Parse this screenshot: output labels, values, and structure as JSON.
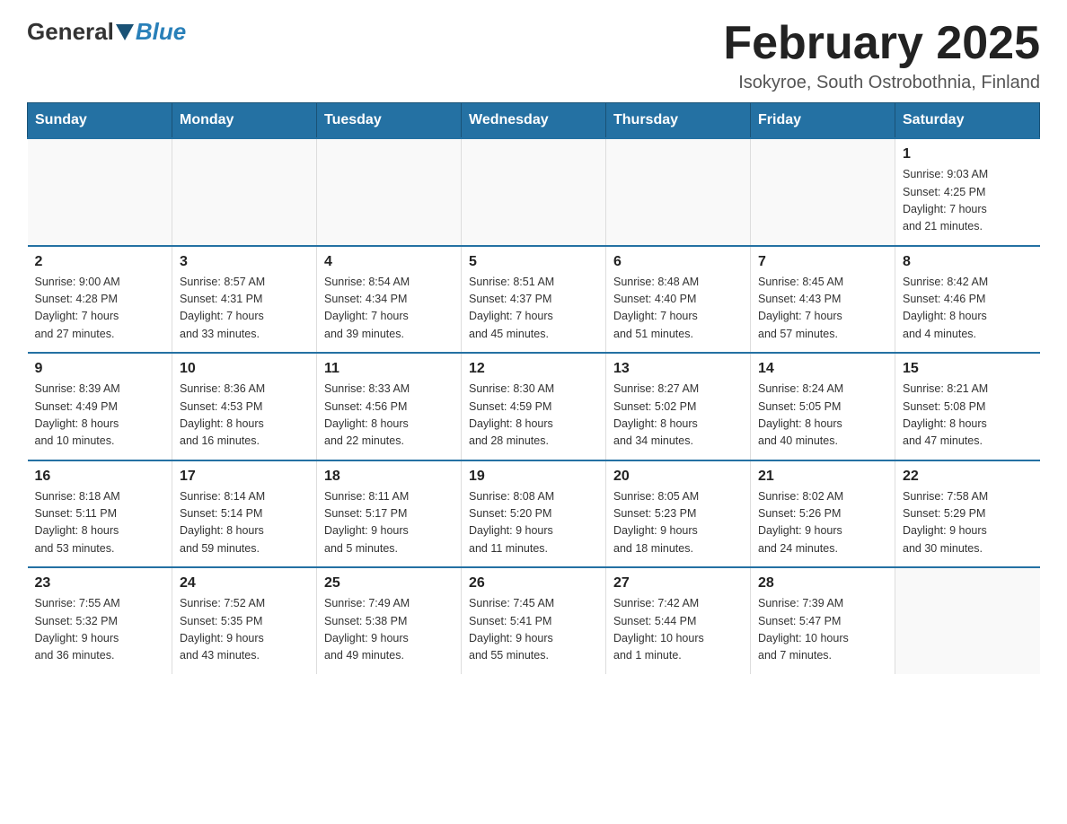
{
  "logo": {
    "general": "General",
    "blue": "Blue"
  },
  "header": {
    "title": "February 2025",
    "subtitle": "Isokyroe, South Ostrobothnia, Finland"
  },
  "days_of_week": [
    "Sunday",
    "Monday",
    "Tuesday",
    "Wednesday",
    "Thursday",
    "Friday",
    "Saturday"
  ],
  "weeks": [
    [
      {
        "day": "",
        "info": ""
      },
      {
        "day": "",
        "info": ""
      },
      {
        "day": "",
        "info": ""
      },
      {
        "day": "",
        "info": ""
      },
      {
        "day": "",
        "info": ""
      },
      {
        "day": "",
        "info": ""
      },
      {
        "day": "1",
        "info": "Sunrise: 9:03 AM\nSunset: 4:25 PM\nDaylight: 7 hours\nand 21 minutes."
      }
    ],
    [
      {
        "day": "2",
        "info": "Sunrise: 9:00 AM\nSunset: 4:28 PM\nDaylight: 7 hours\nand 27 minutes."
      },
      {
        "day": "3",
        "info": "Sunrise: 8:57 AM\nSunset: 4:31 PM\nDaylight: 7 hours\nand 33 minutes."
      },
      {
        "day": "4",
        "info": "Sunrise: 8:54 AM\nSunset: 4:34 PM\nDaylight: 7 hours\nand 39 minutes."
      },
      {
        "day": "5",
        "info": "Sunrise: 8:51 AM\nSunset: 4:37 PM\nDaylight: 7 hours\nand 45 minutes."
      },
      {
        "day": "6",
        "info": "Sunrise: 8:48 AM\nSunset: 4:40 PM\nDaylight: 7 hours\nand 51 minutes."
      },
      {
        "day": "7",
        "info": "Sunrise: 8:45 AM\nSunset: 4:43 PM\nDaylight: 7 hours\nand 57 minutes."
      },
      {
        "day": "8",
        "info": "Sunrise: 8:42 AM\nSunset: 4:46 PM\nDaylight: 8 hours\nand 4 minutes."
      }
    ],
    [
      {
        "day": "9",
        "info": "Sunrise: 8:39 AM\nSunset: 4:49 PM\nDaylight: 8 hours\nand 10 minutes."
      },
      {
        "day": "10",
        "info": "Sunrise: 8:36 AM\nSunset: 4:53 PM\nDaylight: 8 hours\nand 16 minutes."
      },
      {
        "day": "11",
        "info": "Sunrise: 8:33 AM\nSunset: 4:56 PM\nDaylight: 8 hours\nand 22 minutes."
      },
      {
        "day": "12",
        "info": "Sunrise: 8:30 AM\nSunset: 4:59 PM\nDaylight: 8 hours\nand 28 minutes."
      },
      {
        "day": "13",
        "info": "Sunrise: 8:27 AM\nSunset: 5:02 PM\nDaylight: 8 hours\nand 34 minutes."
      },
      {
        "day": "14",
        "info": "Sunrise: 8:24 AM\nSunset: 5:05 PM\nDaylight: 8 hours\nand 40 minutes."
      },
      {
        "day": "15",
        "info": "Sunrise: 8:21 AM\nSunset: 5:08 PM\nDaylight: 8 hours\nand 47 minutes."
      }
    ],
    [
      {
        "day": "16",
        "info": "Sunrise: 8:18 AM\nSunset: 5:11 PM\nDaylight: 8 hours\nand 53 minutes."
      },
      {
        "day": "17",
        "info": "Sunrise: 8:14 AM\nSunset: 5:14 PM\nDaylight: 8 hours\nand 59 minutes."
      },
      {
        "day": "18",
        "info": "Sunrise: 8:11 AM\nSunset: 5:17 PM\nDaylight: 9 hours\nand 5 minutes."
      },
      {
        "day": "19",
        "info": "Sunrise: 8:08 AM\nSunset: 5:20 PM\nDaylight: 9 hours\nand 11 minutes."
      },
      {
        "day": "20",
        "info": "Sunrise: 8:05 AM\nSunset: 5:23 PM\nDaylight: 9 hours\nand 18 minutes."
      },
      {
        "day": "21",
        "info": "Sunrise: 8:02 AM\nSunset: 5:26 PM\nDaylight: 9 hours\nand 24 minutes."
      },
      {
        "day": "22",
        "info": "Sunrise: 7:58 AM\nSunset: 5:29 PM\nDaylight: 9 hours\nand 30 minutes."
      }
    ],
    [
      {
        "day": "23",
        "info": "Sunrise: 7:55 AM\nSunset: 5:32 PM\nDaylight: 9 hours\nand 36 minutes."
      },
      {
        "day": "24",
        "info": "Sunrise: 7:52 AM\nSunset: 5:35 PM\nDaylight: 9 hours\nand 43 minutes."
      },
      {
        "day": "25",
        "info": "Sunrise: 7:49 AM\nSunset: 5:38 PM\nDaylight: 9 hours\nand 49 minutes."
      },
      {
        "day": "26",
        "info": "Sunrise: 7:45 AM\nSunset: 5:41 PM\nDaylight: 9 hours\nand 55 minutes."
      },
      {
        "day": "27",
        "info": "Sunrise: 7:42 AM\nSunset: 5:44 PM\nDaylight: 10 hours\nand 1 minute."
      },
      {
        "day": "28",
        "info": "Sunrise: 7:39 AM\nSunset: 5:47 PM\nDaylight: 10 hours\nand 7 minutes."
      },
      {
        "day": "",
        "info": ""
      }
    ]
  ]
}
